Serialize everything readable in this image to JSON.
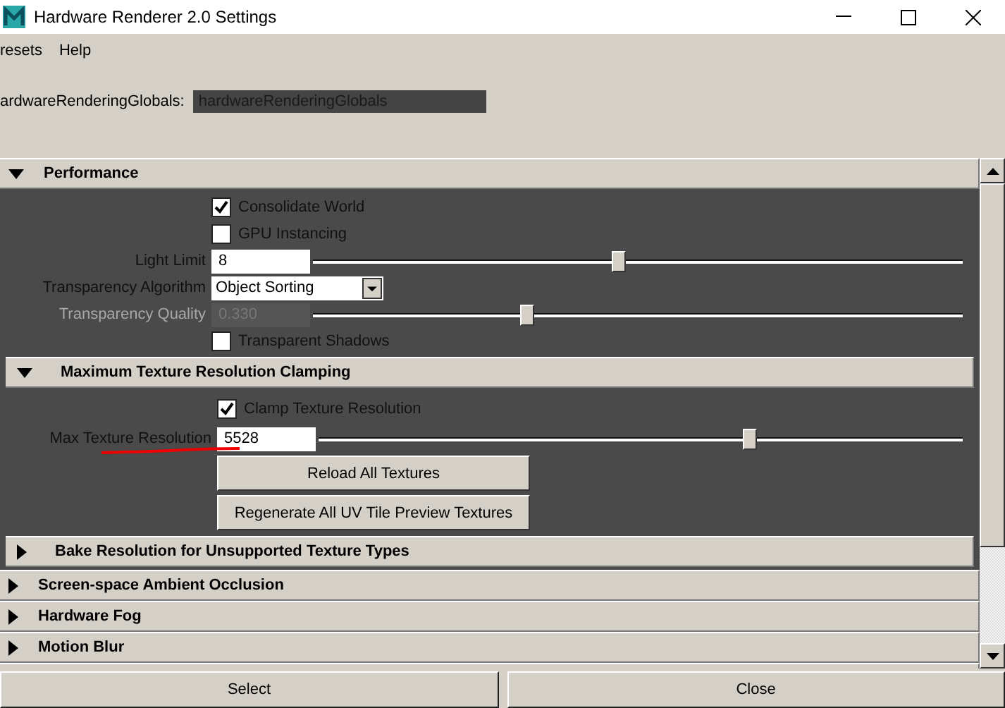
{
  "window": {
    "title": "Hardware Renderer 2.0 Settings"
  },
  "menu": [
    "resets",
    "Help"
  ],
  "node": {
    "label": "ardwareRenderingGlobals:",
    "value": "hardwareRenderingGlobals"
  },
  "sections": [
    {
      "title": "Performance",
      "expanded": true,
      "rows": [
        {
          "kind": "checkbox",
          "label": "Consolidate World",
          "checked": true
        },
        {
          "kind": "checkbox",
          "label": "GPU Instancing",
          "checked": false
        },
        {
          "kind": "slider",
          "label": "Light Limit",
          "value": "8",
          "level": 0.47,
          "disabled": false
        },
        {
          "kind": "dropdown",
          "label": "Transparency Algorithm",
          "value": "Object Sorting"
        },
        {
          "kind": "slider",
          "label": "Transparency Quality",
          "value": "0.330",
          "level": 0.33,
          "disabled": true
        },
        {
          "kind": "checkbox",
          "label": "Transparent Shadows",
          "checked": false
        }
      ],
      "subsections": [
        {
          "title": "Maximum Texture Resolution Clamping",
          "expanded": true,
          "rows": [
            {
              "kind": "checkbox",
              "label": "Clamp Texture Resolution",
              "checked": true
            },
            {
              "kind": "slider",
              "label": "Max Texture Resolution",
              "value": "5528",
              "level": 0.67,
              "disabled": false,
              "underlined": true
            },
            {
              "kind": "button",
              "label": "Reload All Textures"
            },
            {
              "kind": "button",
              "label": "Regenerate All UV Tile Preview Textures"
            }
          ]
        },
        {
          "title": "Bake Resolution for Unsupported Texture Types",
          "expanded": false
        }
      ]
    },
    {
      "title": "Screen-space Ambient Occlusion",
      "expanded": false
    },
    {
      "title": "Hardware Fog",
      "expanded": false
    },
    {
      "title": "Motion Blur",
      "expanded": false
    },
    {
      "expanded": false
    }
  ],
  "footer": [
    "Select",
    "Close"
  ]
}
